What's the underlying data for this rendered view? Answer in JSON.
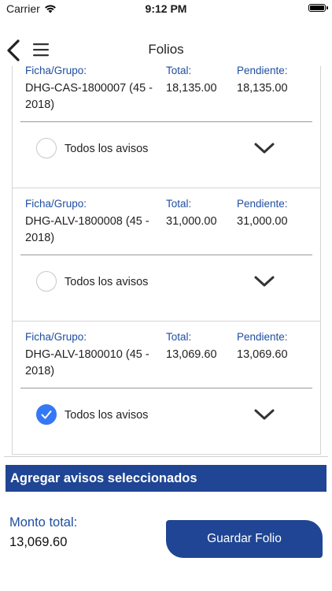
{
  "status_bar": {
    "carrier": "Carrier",
    "time": "9:12 PM"
  },
  "nav": {
    "title": "Folios"
  },
  "columns": {
    "ficha": "Ficha/Grupo:",
    "total": "Total:",
    "pendiente": "Pendiente:"
  },
  "folios": [
    {
      "ficha": "DHG-CAS-1800007 (45 - 2018)",
      "total": "18,135.00",
      "pendiente": "18,135.00",
      "checkbox_label": "Todos los avisos",
      "checked": false
    },
    {
      "ficha": "DHG-ALV-1800008 (45 - 2018)",
      "total": "31,000.00",
      "pendiente": "31,000.00",
      "checkbox_label": "Todos los avisos",
      "checked": false
    },
    {
      "ficha": "DHG-ALV-1800010 (45 - 2018)",
      "total": "13,069.60",
      "pendiente": "13,069.60",
      "checkbox_label": "Todos los avisos",
      "checked": true
    }
  ],
  "add_button": {
    "label": "Agregar avisos seleccionados"
  },
  "summary": {
    "total_label": "Monto total:",
    "total_value": "13,069.60"
  },
  "save_button": {
    "label": "Guardar Folio"
  },
  "colors": {
    "primary": "#1f4594",
    "label_blue": "#1f4ea1",
    "check_blue": "#3478f6"
  },
  "icons": {
    "back": "chevron-left-icon",
    "menu": "hamburger-menu-icon",
    "expand": "chevron-down-icon",
    "check": "checkmark-icon",
    "wifi": "wifi-icon",
    "battery": "battery-icon"
  }
}
